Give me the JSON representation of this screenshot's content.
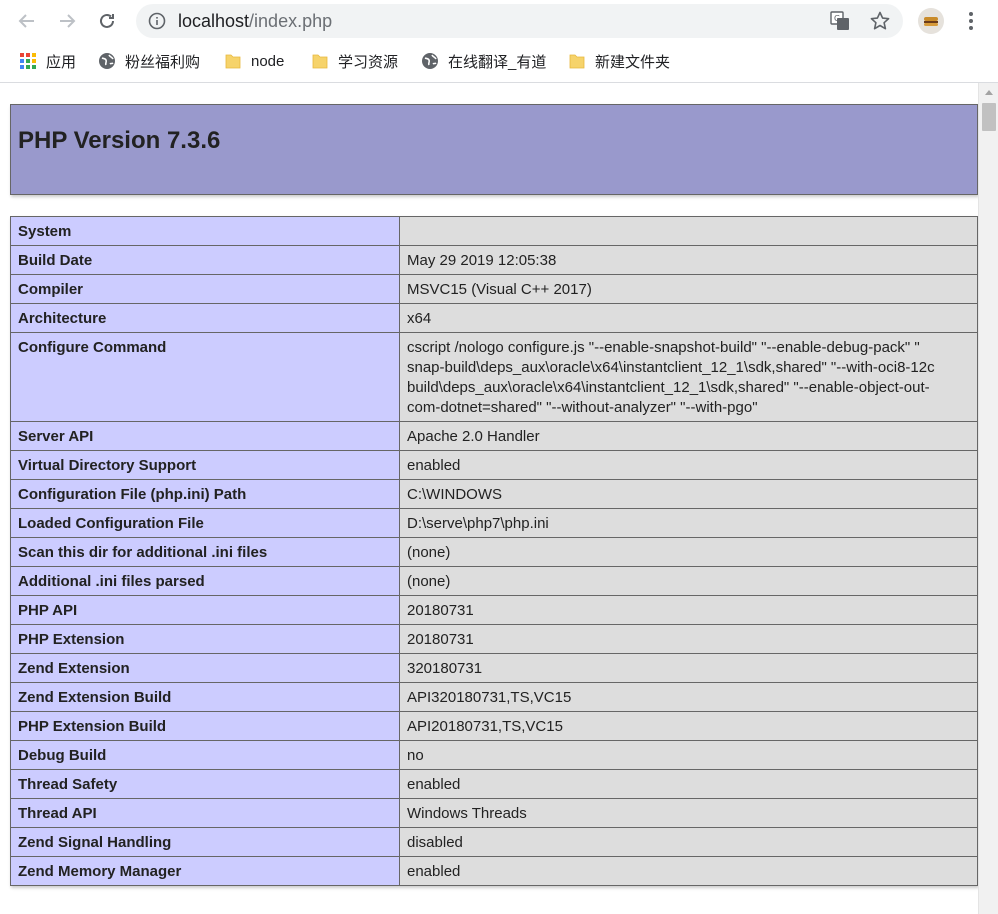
{
  "browser": {
    "url_host": "localhost",
    "url_path": "/index.php",
    "bookmarks": [
      {
        "label": "应用",
        "icon": "apps-grid-icon"
      },
      {
        "label": "粉丝福利购",
        "icon": "globe-icon"
      },
      {
        "label": "node",
        "icon": "folder-icon"
      },
      {
        "label": "学习资源",
        "icon": "folder-icon"
      },
      {
        "label": "在线翻译_有道",
        "icon": "globe-icon"
      },
      {
        "label": "新建文件夹",
        "icon": "folder-icon"
      }
    ]
  },
  "page": {
    "title": "PHP Version 7.3.6",
    "rows": [
      {
        "label": "System",
        "value": ""
      },
      {
        "label": "Build Date",
        "value": "May 29 2019 12:05:38"
      },
      {
        "label": "Compiler",
        "value": "MSVC15 (Visual C++ 2017)"
      },
      {
        "label": "Architecture",
        "value": "x64"
      },
      {
        "label": "Configure Command",
        "value": [
          "cscript /nologo configure.js \"--enable-snapshot-build\" \"--enable-debug-pack\" \"",
          "snap-build\\deps_aux\\oracle\\x64\\instantclient_12_1\\sdk,shared\" \"--with-oci8-12c",
          "build\\deps_aux\\oracle\\x64\\instantclient_12_1\\sdk,shared\" \"--enable-object-out-",
          "com-dotnet=shared\" \"--without-analyzer\" \"--with-pgo\""
        ]
      },
      {
        "label": "Server API",
        "value": "Apache 2.0 Handler"
      },
      {
        "label": "Virtual Directory Support",
        "value": "enabled"
      },
      {
        "label": "Configuration File (php.ini) Path",
        "value": "C:\\WINDOWS"
      },
      {
        "label": "Loaded Configuration File",
        "value": "D:\\serve\\php7\\php.ini"
      },
      {
        "label": "Scan this dir for additional .ini files",
        "value": "(none)"
      },
      {
        "label": "Additional .ini files parsed",
        "value": "(none)"
      },
      {
        "label": "PHP API",
        "value": "20180731"
      },
      {
        "label": "PHP Extension",
        "value": "20180731"
      },
      {
        "label": "Zend Extension",
        "value": "320180731"
      },
      {
        "label": "Zend Extension Build",
        "value": "API320180731,TS,VC15"
      },
      {
        "label": "PHP Extension Build",
        "value": "API20180731,TS,VC15"
      },
      {
        "label": "Debug Build",
        "value": "no"
      },
      {
        "label": "Thread Safety",
        "value": "enabled"
      },
      {
        "label": "Thread API",
        "value": "Windows Threads"
      },
      {
        "label": "Zend Signal Handling",
        "value": "disabled"
      },
      {
        "label": "Zend Memory Manager",
        "value": "enabled"
      }
    ]
  },
  "colors": {
    "header_bg": "#9999cc",
    "label_cell_bg": "#ccccff",
    "value_cell_bg": "#dddddd"
  }
}
